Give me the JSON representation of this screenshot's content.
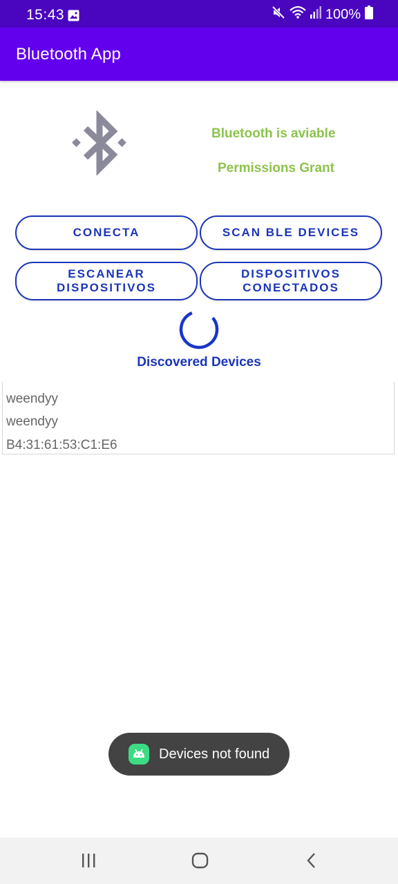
{
  "status_bar": {
    "time": "15:43",
    "battery": "100%",
    "icons": [
      "gallery-icon",
      "mute-icon",
      "wifi-icon",
      "signal-icon",
      "battery-icon"
    ],
    "background": "#4a06bf"
  },
  "app_bar": {
    "title": "Bluetooth App",
    "background": "#6200ee"
  },
  "bluetooth": {
    "icon": "bluetooth-icon",
    "available_text": "Bluetooth is aviable",
    "permission_text": "Permissions Grant",
    "status_color": "#8bc34a"
  },
  "buttons": {
    "connect": "CONECTA",
    "scan_ble": "SCAN BLE DEVICES",
    "escanear_line1": "ESCANEAR",
    "escanear_line2": "DISPOSITIVOS",
    "conectados_line1": "DISPOSITIVOS",
    "conectados_line2": "CONECTADOS",
    "accent": "#1a35b8"
  },
  "discovered": {
    "title": "Discovered Devices",
    "devices": [
      "weendyy",
      "weendyy",
      "B4:31:61:53:C1:E6"
    ]
  },
  "toast": {
    "icon": "android-icon",
    "text": "Devices not found"
  },
  "nav_bar": {
    "icons": [
      "recent-apps-icon",
      "home-icon",
      "back-icon"
    ]
  }
}
